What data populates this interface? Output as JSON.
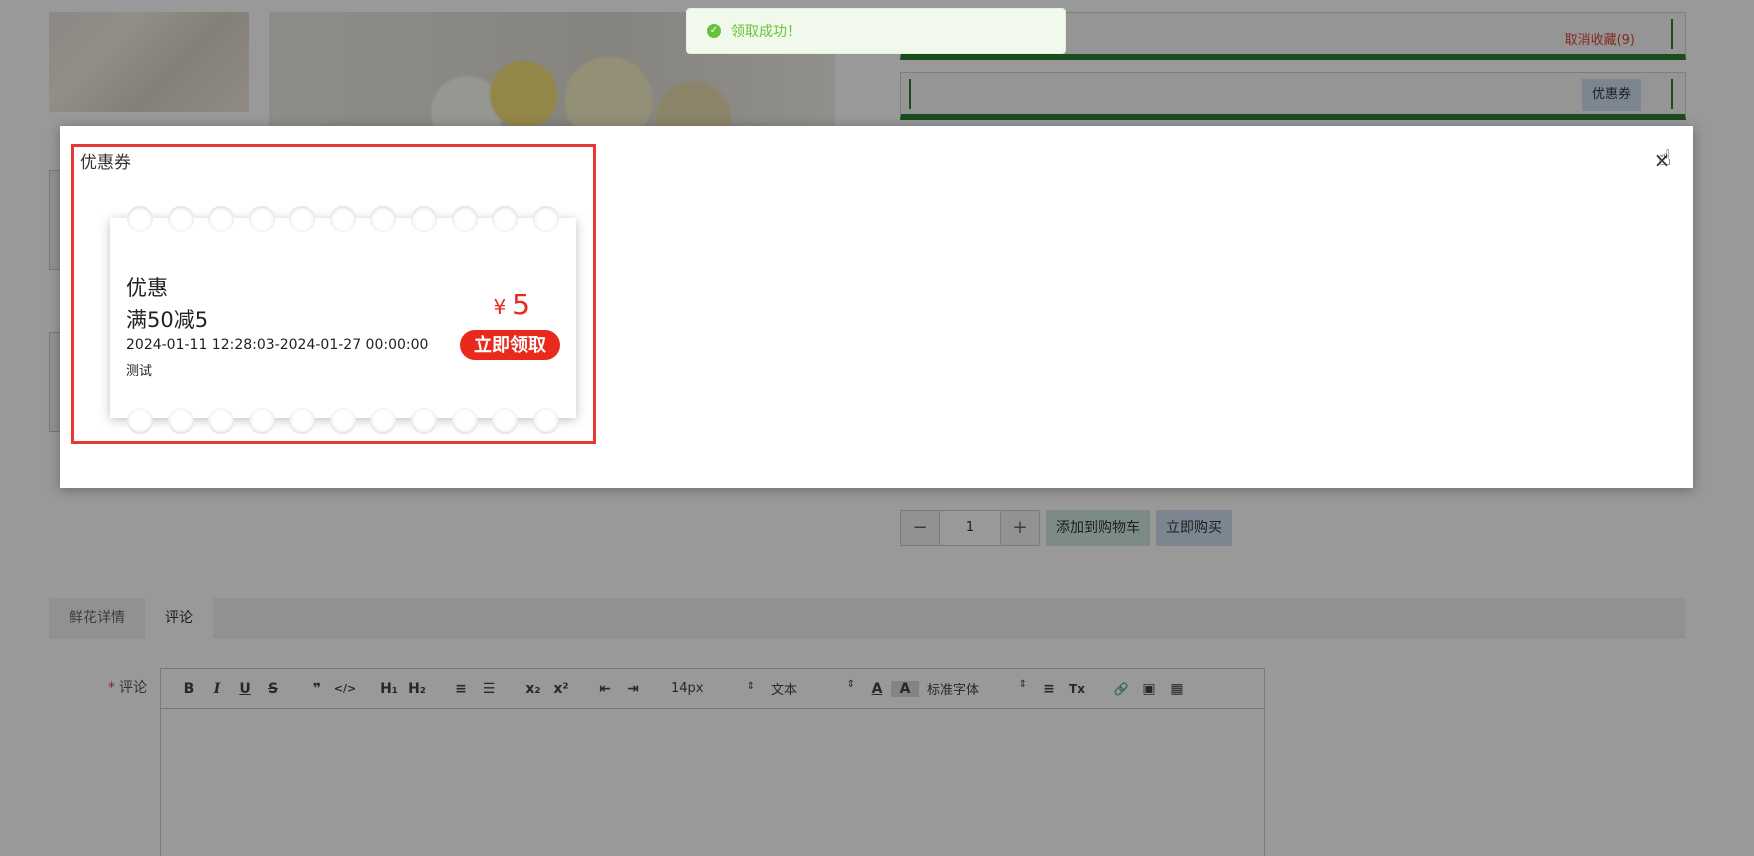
{
  "background": {
    "favorite_link": "取消收藏(9)",
    "coupon_chip": "优惠券",
    "quantity": "1",
    "minus_label": "−",
    "plus_label": "+",
    "add_cart_label": "添加到购物车",
    "buy_now_label": "立即购买",
    "tabs": [
      {
        "label": "鲜花详情"
      },
      {
        "label": "评论"
      }
    ],
    "comment_label": "评论",
    "required_mark": "*",
    "toolbar": {
      "bold": "B",
      "italic": "I",
      "underline": "U",
      "strike": "S",
      "quote": "❞",
      "code": "</>",
      "h1": "H₁",
      "h2": "H₂",
      "ordered_list": "≡",
      "bullet_list": "☰",
      "subscript": "x₂",
      "superscript": "x²",
      "outdent": "⇤",
      "indent": "⇥",
      "size_value": "14px",
      "format_value": "文本",
      "font_color": "A",
      "bg_color": "A",
      "font_value": "标准字体",
      "align": "≡",
      "clear": "Tx",
      "link": "🔗",
      "image": "▣",
      "video": "▦"
    }
  },
  "toast": {
    "icon": "check-circle-icon",
    "message": "领取成功！"
  },
  "dialog": {
    "title": "优惠券",
    "close": "×",
    "coupon": {
      "name": "优惠",
      "rule": "满50减5",
      "date_range": "2024-01-11 12:28:03-2024-01-27 00:00:00",
      "description": "测试",
      "currency_symbol": "¥",
      "amount": "5",
      "claim_label": "立即领取"
    }
  },
  "colors": {
    "accent_red": "#e8291c",
    "highlight_red": "#e53935",
    "success_green": "#67c23a",
    "bar_green": "#2e7d32"
  }
}
